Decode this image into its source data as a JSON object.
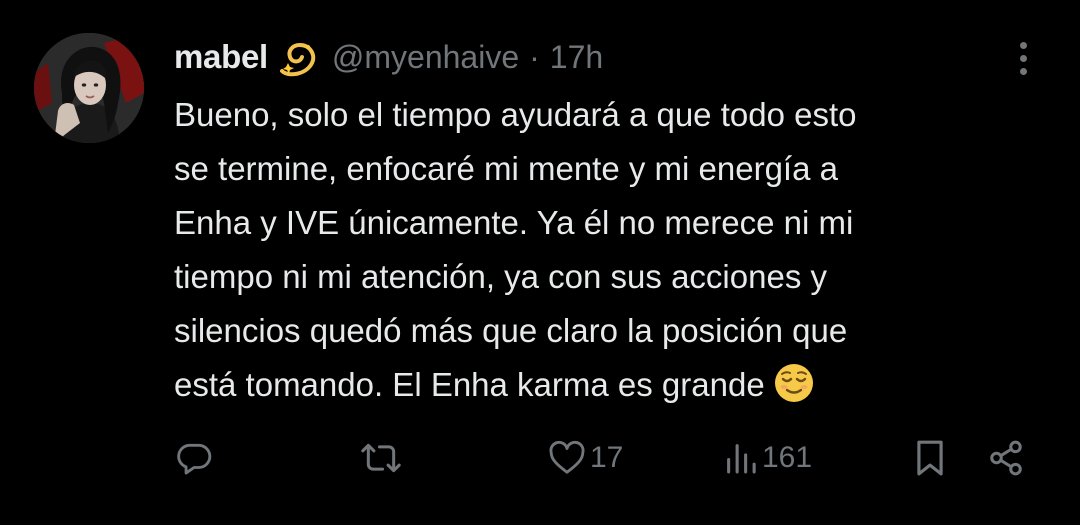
{
  "tweet": {
    "display_name": "mabel",
    "name_emoji": "dizzy-emoji",
    "handle": "@myenhaive",
    "separator": "·",
    "time": "17h",
    "text_lines": [
      "Bueno, solo el tiempo ayudará a que todo esto",
      "se termine, enfocaré mi mente y mi energía a",
      "Enha y IVE únicamente. Ya él no merece ni mi",
      "tiempo ni mi atención, ya con sus acciones y",
      "silencios quedó más que claro la posición que",
      "está tomando. El Enha karma es grande"
    ],
    "end_emoji": "relieved-face-emoji"
  },
  "actions": {
    "reply_icon": "reply-icon",
    "retweet_icon": "retweet-icon",
    "like_icon": "heart-icon",
    "like_count": "17",
    "views_icon": "views-icon",
    "views_count": "161",
    "bookmark_icon": "bookmark-icon",
    "share_icon": "share-icon"
  },
  "colors": {
    "background": "#000000",
    "primary_text": "#e7e9ea",
    "secondary_text": "#71767b"
  }
}
